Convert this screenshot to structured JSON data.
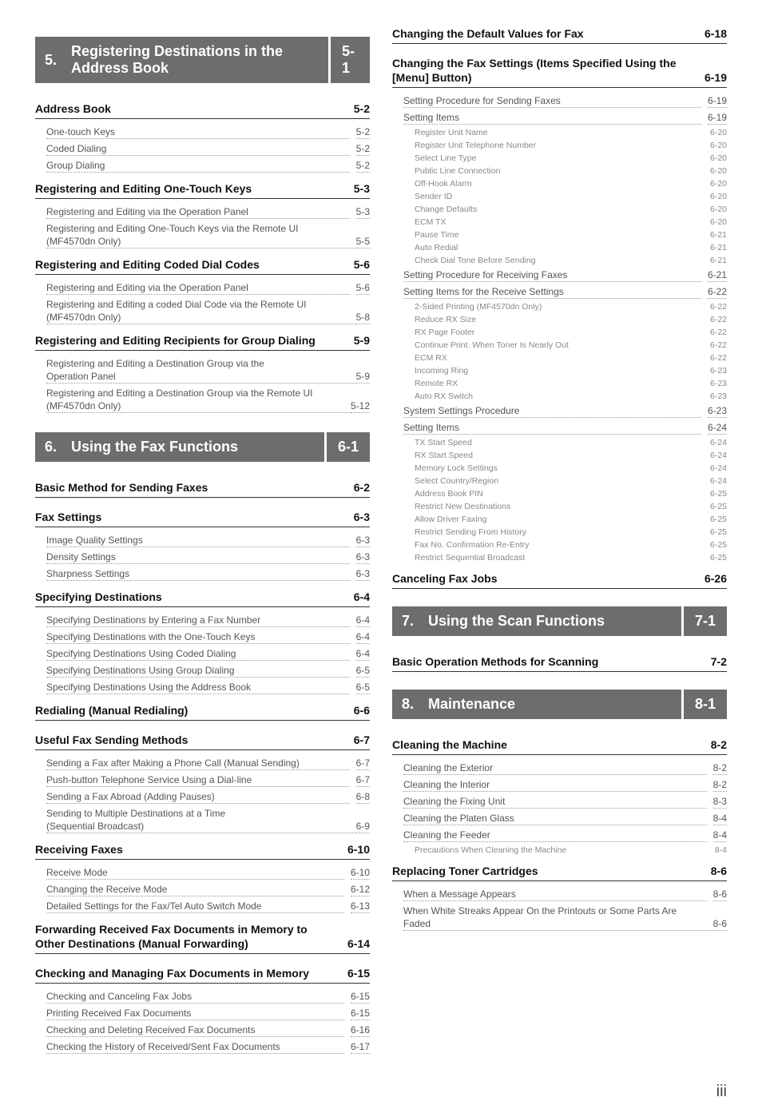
{
  "columns": [
    {
      "blocks": [
        {
          "type": "chapter",
          "num": "5.",
          "title": "Registering Destinations in the Address Book",
          "page": "5-1"
        },
        {
          "type": "lvl1",
          "label": "Address Book",
          "page": "5-2"
        },
        {
          "type": "lvl2",
          "label": "One-touch Keys",
          "page": "5-2"
        },
        {
          "type": "lvl2",
          "label": "Coded Dialing",
          "page": "5-2"
        },
        {
          "type": "lvl2",
          "label": "Group Dialing",
          "page": "5-2"
        },
        {
          "type": "lvl1",
          "label": "Registering and Editing One-Touch Keys",
          "page": "5-3"
        },
        {
          "type": "lvl2",
          "label": "Registering and Editing via the Operation Panel",
          "page": "5-3"
        },
        {
          "type": "lvl2wrap",
          "first": "Registering and Editing One-Touch Keys via the Remote UI",
          "last": "(MF4570dn Only)",
          "page": "5-5"
        },
        {
          "type": "lvl1",
          "label": "Registering and Editing Coded Dial Codes",
          "page": "5-6"
        },
        {
          "type": "lvl2",
          "label": "Registering and Editing via the Operation Panel",
          "page": "5-6"
        },
        {
          "type": "lvl2wrap",
          "first": "Registering and Editing a coded Dial Code via the Remote UI",
          "last": "(MF4570dn Only)",
          "page": "5-8"
        },
        {
          "type": "lvl1",
          "label": "Registering and Editing Recipients for Group Dialing",
          "page": "5-9"
        },
        {
          "type": "lvl2wrap",
          "first": "Registering and Editing a Destination Group via the",
          "last": "Operation Panel",
          "page": "5-9"
        },
        {
          "type": "lvl2wrap",
          "first": "Registering and Editing a Destination Group via the Remote UI",
          "last": "(MF4570dn Only)",
          "page": "5-12"
        },
        {
          "type": "chapter",
          "num": "6.",
          "title": "Using the Fax Functions",
          "page": "6-1"
        },
        {
          "type": "lvl1",
          "label": "Basic Method for Sending Faxes",
          "page": "6-2"
        },
        {
          "type": "lvl1",
          "label": "Fax Settings",
          "page": "6-3"
        },
        {
          "type": "lvl2",
          "label": "Image Quality Settings",
          "page": "6-3"
        },
        {
          "type": "lvl2",
          "label": "Density Settings",
          "page": "6-3"
        },
        {
          "type": "lvl2",
          "label": "Sharpness Settings",
          "page": "6-3"
        },
        {
          "type": "lvl1",
          "label": "Specifying Destinations",
          "page": "6-4"
        },
        {
          "type": "lvl2",
          "label": "Specifying Destinations by Entering a Fax Number",
          "page": "6-4"
        },
        {
          "type": "lvl2",
          "label": "Specifying Destinations with the One-Touch Keys",
          "page": "6-4"
        },
        {
          "type": "lvl2",
          "label": "Specifying Destinations Using Coded Dialing",
          "page": "6-4"
        },
        {
          "type": "lvl2",
          "label": "Specifying Destinations Using Group Dialing",
          "page": "6-5"
        },
        {
          "type": "lvl2",
          "label": "Specifying Destinations Using the Address Book",
          "page": "6-5"
        },
        {
          "type": "lvl1",
          "label": "Redialing (Manual Redialing)",
          "page": "6-6"
        },
        {
          "type": "lvl1",
          "label": "Useful Fax Sending Methods",
          "page": "6-7"
        },
        {
          "type": "lvl2",
          "label": "Sending a Fax after Making a Phone Call (Manual Sending)",
          "page": "6-7"
        },
        {
          "type": "lvl2",
          "label": "Push-button Telephone Service Using a Dial-line",
          "page": "6-7"
        },
        {
          "type": "lvl2",
          "label": "Sending a Fax Abroad (Adding Pauses)",
          "page": "6-8"
        },
        {
          "type": "lvl2wrap",
          "first": "Sending to Multiple Destinations at a Time",
          "last": "(Sequential Broadcast)",
          "page": "6-9"
        },
        {
          "type": "lvl1",
          "label": "Receiving Faxes",
          "page": "6-10"
        },
        {
          "type": "lvl2",
          "label": "Receive Mode",
          "page": "6-10"
        },
        {
          "type": "lvl2",
          "label": "Changing the Receive Mode",
          "page": "6-12"
        },
        {
          "type": "lvl2",
          "label": "Detailed Settings for the Fax/Tel Auto Switch Mode",
          "page": "6-13"
        },
        {
          "type": "lvl1wrap",
          "first": "Forwarding Received Fax Documents in Memory to",
          "last": "Other Destinations (Manual Forwarding)",
          "page": "6-14"
        },
        {
          "type": "lvl1",
          "label": "Checking and Managing Fax Documents in Memory",
          "page": "6-15"
        },
        {
          "type": "lvl2",
          "label": "Checking and Canceling Fax Jobs",
          "page": "6-15"
        },
        {
          "type": "lvl2",
          "label": "Printing Received Fax Documents",
          "page": "6-15"
        },
        {
          "type": "lvl2",
          "label": "Checking and Deleting Received Fax Documents",
          "page": "6-16"
        },
        {
          "type": "lvl2",
          "label": "Checking the History of Received/Sent Fax Documents",
          "page": "6-17"
        }
      ]
    },
    {
      "blocks": [
        {
          "type": "lvl1",
          "label": "Changing the Default Values for Fax",
          "page": "6-18"
        },
        {
          "type": "lvl1wrap",
          "first": "Changing the Fax Settings (Items Specified Using the",
          "last": "[Menu] Button)",
          "page": "6-19"
        },
        {
          "type": "lvl2",
          "label": "Setting Procedure for Sending Faxes",
          "page": "6-19"
        },
        {
          "type": "lvl2",
          "label": "Setting Items",
          "page": "6-19"
        },
        {
          "type": "lvl3",
          "label": "Register Unit Name",
          "page": "6-20"
        },
        {
          "type": "lvl3",
          "label": "Register Unit Telephone Number",
          "page": "6-20"
        },
        {
          "type": "lvl3",
          "label": "Select Line Type",
          "page": "6-20"
        },
        {
          "type": "lvl3",
          "label": "Public Line Connection",
          "page": "6-20"
        },
        {
          "type": "lvl3",
          "label": "Off-Hook Alarm",
          "page": "6-20"
        },
        {
          "type": "lvl3",
          "label": "Sender ID",
          "page": "6-20"
        },
        {
          "type": "lvl3",
          "label": "Change Defaults",
          "page": "6-20"
        },
        {
          "type": "lvl3",
          "label": "ECM TX",
          "page": "6-20"
        },
        {
          "type": "lvl3",
          "label": "Pause Time",
          "page": "6-21"
        },
        {
          "type": "lvl3",
          "label": "Auto Redial",
          "page": "6-21"
        },
        {
          "type": "lvl3",
          "label": "Check Dial Tone Before Sending",
          "page": "6-21"
        },
        {
          "type": "lvl2",
          "label": "Setting Procedure for Receiving Faxes",
          "page": "6-21"
        },
        {
          "type": "lvl2",
          "label": "Setting Items for the Receive Settings",
          "page": "6-22"
        },
        {
          "type": "lvl3",
          "label": "2-Sided Printing (MF4570dn Only)",
          "page": "6-22"
        },
        {
          "type": "lvl3",
          "label": "Reduce RX Size",
          "page": "6-22"
        },
        {
          "type": "lvl3",
          "label": "RX Page Footer",
          "page": "6-22"
        },
        {
          "type": "lvl3",
          "label": "Continue Print. When Toner Is Nearly Out",
          "page": "6-22"
        },
        {
          "type": "lvl3",
          "label": "ECM RX",
          "page": "6-22"
        },
        {
          "type": "lvl3",
          "label": "Incoming Ring",
          "page": "6-23"
        },
        {
          "type": "lvl3",
          "label": "Remote RX",
          "page": "6-23"
        },
        {
          "type": "lvl3",
          "label": "Auto RX Switch",
          "page": "6-23"
        },
        {
          "type": "lvl2",
          "label": "System Settings Procedure",
          "page": "6-23"
        },
        {
          "type": "lvl2",
          "label": "Setting Items",
          "page": "6-24"
        },
        {
          "type": "lvl3",
          "label": "TX Start Speed",
          "page": "6-24"
        },
        {
          "type": "lvl3",
          "label": "RX Start Speed",
          "page": "6-24"
        },
        {
          "type": "lvl3",
          "label": "Memory Lock Settings",
          "page": "6-24"
        },
        {
          "type": "lvl3",
          "label": "Select Country/Region",
          "page": "6-24"
        },
        {
          "type": "lvl3",
          "label": "Address Book PIN",
          "page": "6-25"
        },
        {
          "type": "lvl3",
          "label": "Restrict New Destinations",
          "page": "6-25"
        },
        {
          "type": "lvl3",
          "label": "Allow Driver Faxing",
          "page": "6-25"
        },
        {
          "type": "lvl3",
          "label": "Restrict Sending From History",
          "page": "6-25"
        },
        {
          "type": "lvl3",
          "label": "Fax No. Confirmation Re-Entry",
          "page": "6-25"
        },
        {
          "type": "lvl3",
          "label": "Restrict Sequential Broadcast",
          "page": "6-25"
        },
        {
          "type": "lvl1",
          "label": "Canceling Fax Jobs",
          "page": "6-26"
        },
        {
          "type": "chapter",
          "num": "7.",
          "title": "Using the Scan Functions",
          "page": "7-1"
        },
        {
          "type": "lvl1",
          "label": "Basic Operation Methods for Scanning",
          "page": "7-2"
        },
        {
          "type": "chapter",
          "num": "8.",
          "title": "Maintenance",
          "page": "8-1"
        },
        {
          "type": "lvl1",
          "label": "Cleaning the Machine",
          "page": "8-2"
        },
        {
          "type": "lvl2",
          "label": "Cleaning the Exterior",
          "page": "8-2"
        },
        {
          "type": "lvl2",
          "label": "Cleaning the Interior",
          "page": "8-2"
        },
        {
          "type": "lvl2",
          "label": "Cleaning the Fixing Unit",
          "page": "8-3"
        },
        {
          "type": "lvl2",
          "label": "Cleaning the Platen Glass",
          "page": "8-4"
        },
        {
          "type": "lvl2",
          "label": "Cleaning the Feeder",
          "page": "8-4"
        },
        {
          "type": "lvl3",
          "label": "Precautions When Cleaning the Machine",
          "page": "8-4"
        },
        {
          "type": "lvl1",
          "label": "Replacing Toner Cartridges",
          "page": "8-6"
        },
        {
          "type": "lvl2",
          "label": "When a Message Appears",
          "page": "8-6"
        },
        {
          "type": "lvl2wrap",
          "first": "When White Streaks Appear On the Printouts or Some Parts Are",
          "last": "Faded",
          "page": "8-6"
        }
      ]
    }
  ],
  "footer": "iii"
}
